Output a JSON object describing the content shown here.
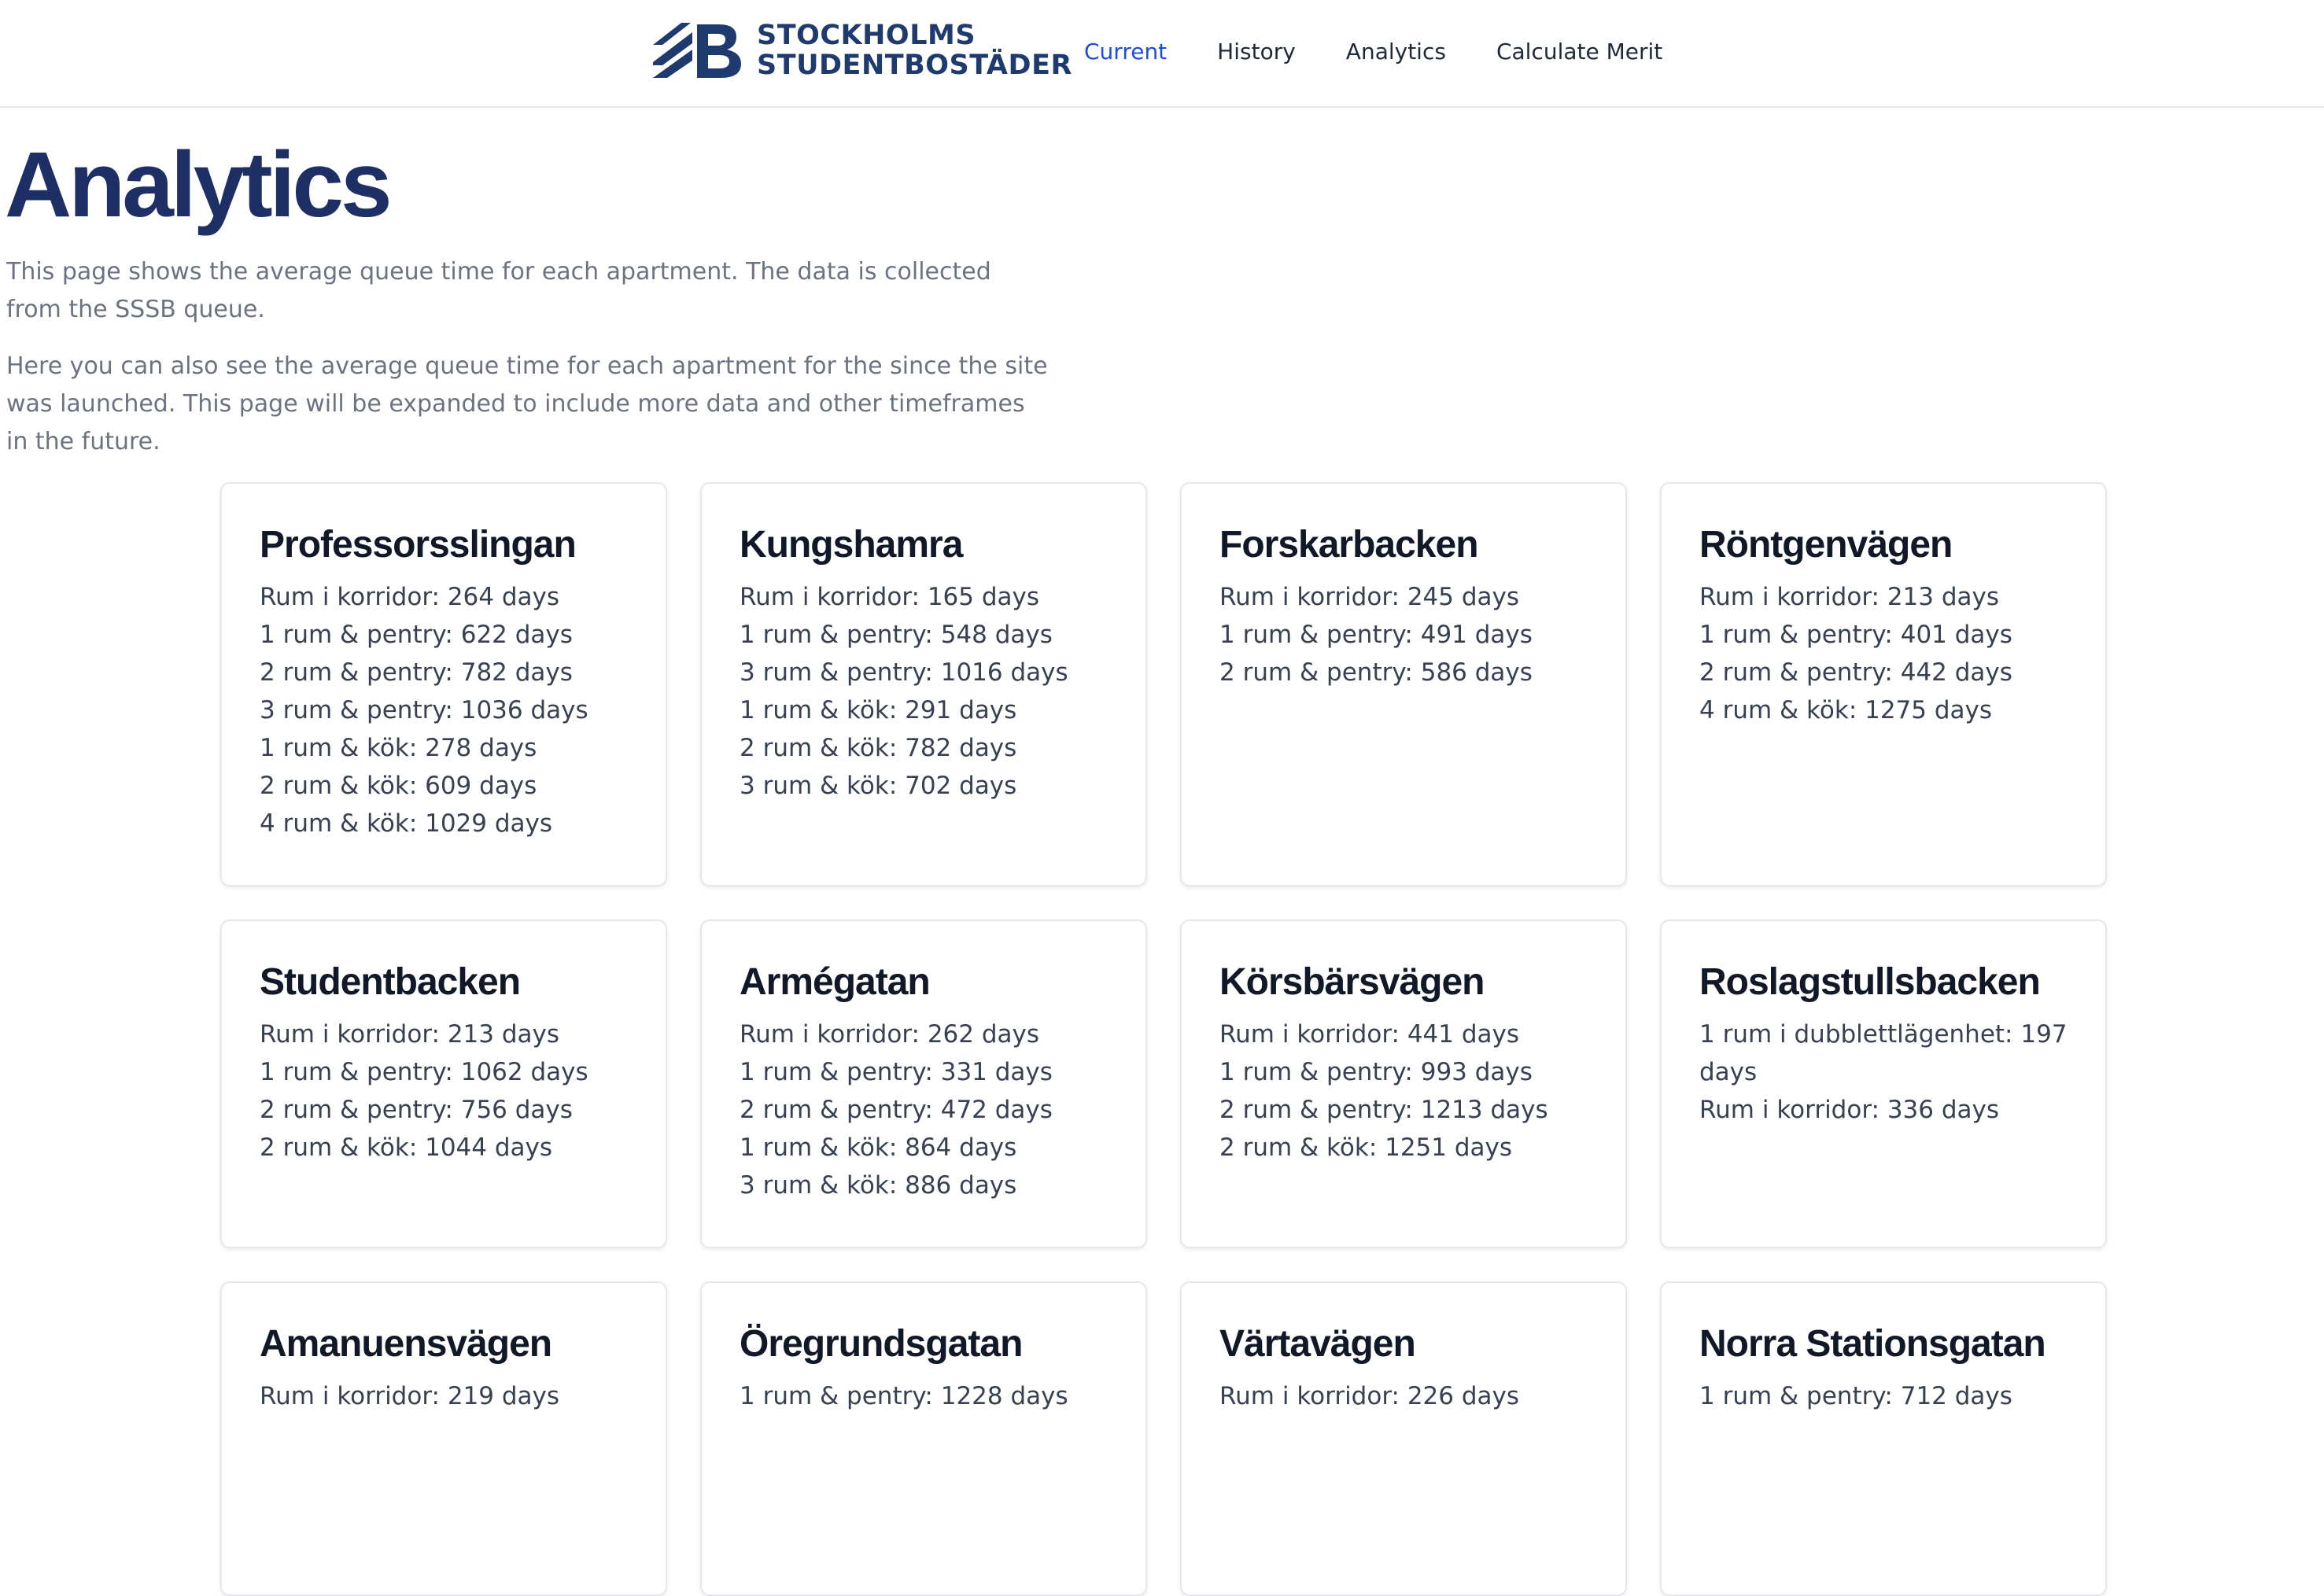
{
  "header": {
    "logo_line1": "STOCKHOLMS",
    "logo_line2": "STUDENTBOSTÄDER",
    "nav": [
      "Current",
      "History",
      "Analytics",
      "Calculate Merit"
    ],
    "active_nav": "Current",
    "accent_color": "#1d4ed8",
    "brand_color": "#1e3a6e"
  },
  "page": {
    "title": "Analytics",
    "intro1": "This page shows the average queue time for each apartment. The data is collected from the SSSB queue.",
    "intro2": "Here you can also see the average queue time for each apartment for the since the site was launched. This page will be expanded to include more data and other timeframes in the future."
  },
  "cards": [
    {
      "name": "Professorsslingan",
      "lines": [
        "Rum i korridor: 264 days",
        "1 rum & pentry: 622 days",
        "2 rum & pentry: 782 days",
        "3 rum & pentry: 1036 days",
        "1 rum & kök: 278 days",
        "2 rum & kök: 609 days",
        "4 rum & kök: 1029 days"
      ]
    },
    {
      "name": "Kungshamra",
      "lines": [
        "Rum i korridor: 165 days",
        "1 rum & pentry: 548 days",
        "3 rum & pentry: 1016 days",
        "1 rum & kök: 291 days",
        "2 rum & kök: 782 days",
        "3 rum & kök: 702 days"
      ]
    },
    {
      "name": "Forskarbacken",
      "lines": [
        "Rum i korridor: 245 days",
        "1 rum & pentry: 491 days",
        "2 rum & pentry: 586 days"
      ]
    },
    {
      "name": "Röntgenvägen",
      "lines": [
        "Rum i korridor: 213 days",
        "1 rum & pentry: 401 days",
        "2 rum & pentry: 442 days",
        "4 rum & kök: 1275 days"
      ]
    },
    {
      "name": "Studentbacken",
      "lines": [
        "Rum i korridor: 213 days",
        "1 rum & pentry: 1062 days",
        "2 rum & pentry: 756 days",
        "2 rum & kök: 1044 days"
      ]
    },
    {
      "name": "Armégatan",
      "lines": [
        "Rum i korridor: 262 days",
        "1 rum & pentry: 331 days",
        "2 rum & pentry: 472 days",
        "1 rum & kök: 864 days",
        "3 rum & kök: 886 days"
      ]
    },
    {
      "name": "Körsbärsvägen",
      "lines": [
        "Rum i korridor: 441 days",
        "1 rum & pentry: 993 days",
        "2 rum & pentry: 1213 days",
        "2 rum & kök: 1251 days"
      ]
    },
    {
      "name": "Roslagstullsbacken",
      "lines": [
        "1 rum i dubblettlägenhet: 197 days",
        "Rum i korridor: 336 days"
      ]
    },
    {
      "name": "Amanuensvägen",
      "lines": [
        "Rum i korridor: 219 days"
      ]
    },
    {
      "name": "Öregrundsgatan",
      "lines": [
        "1 rum & pentry: 1228 days"
      ]
    },
    {
      "name": "Värtavägen",
      "lines": [
        "Rum i korridor: 226 days"
      ]
    },
    {
      "name": "Norra Stationsgatan",
      "lines": [
        "1 rum & pentry: 712 days"
      ]
    }
  ]
}
